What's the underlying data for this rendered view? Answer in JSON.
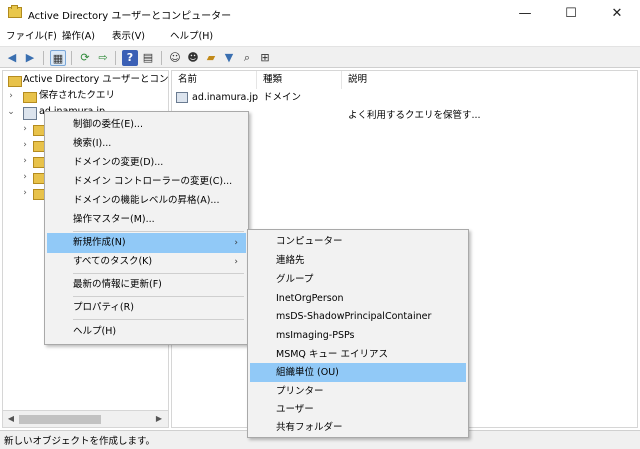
{
  "window": {
    "title": "Active Directory ユーザーとコンピューター",
    "minimize": "—",
    "maximize": "☐",
    "close": "✕"
  },
  "menubar": [
    "ファイル(F)",
    "操作(A)",
    "表示(V)",
    "ヘルプ(H)"
  ],
  "tree": {
    "root": "Active Directory ユーザーとコンピュー",
    "saved_queries": "保存されたクエリ",
    "domain": "ad.inamura.jp"
  },
  "columns": {
    "name": "名前",
    "type": "種類",
    "description": "説明"
  },
  "rows": [
    {
      "name": "ad.inamura.jp",
      "type": "ドメイン",
      "description": ""
    },
    {
      "name": "",
      "type": "",
      "description": "よく利用するクエリを保管す..."
    }
  ],
  "context_menu": {
    "items": [
      "制御の委任(E)...",
      "検索(I)...",
      "ドメインの変更(D)...",
      "ドメイン コントローラーの変更(C)...",
      "ドメインの機能レベルの昇格(A)...",
      "操作マスター(M)...",
      "新規作成(N)",
      "すべてのタスク(K)",
      "最新の情報に更新(F)",
      "プロパティ(R)",
      "ヘルプ(H)"
    ],
    "highlighted": "新規作成(N)"
  },
  "submenu": {
    "items": [
      "コンピューター",
      "連絡先",
      "グループ",
      "InetOrgPerson",
      "msDS-ShadowPrincipalContainer",
      "msImaging-PSPs",
      "MSMQ キュー エイリアス",
      "組織単位 (OU)",
      "プリンター",
      "ユーザー",
      "共有フォルダー"
    ],
    "highlighted": "組織単位 (OU)"
  },
  "status": "新しいオブジェクトを作成します。",
  "colors": {
    "highlight": "#91c9f7",
    "menu_bg": "#f2f2f2",
    "folder": "#e8c24a"
  }
}
